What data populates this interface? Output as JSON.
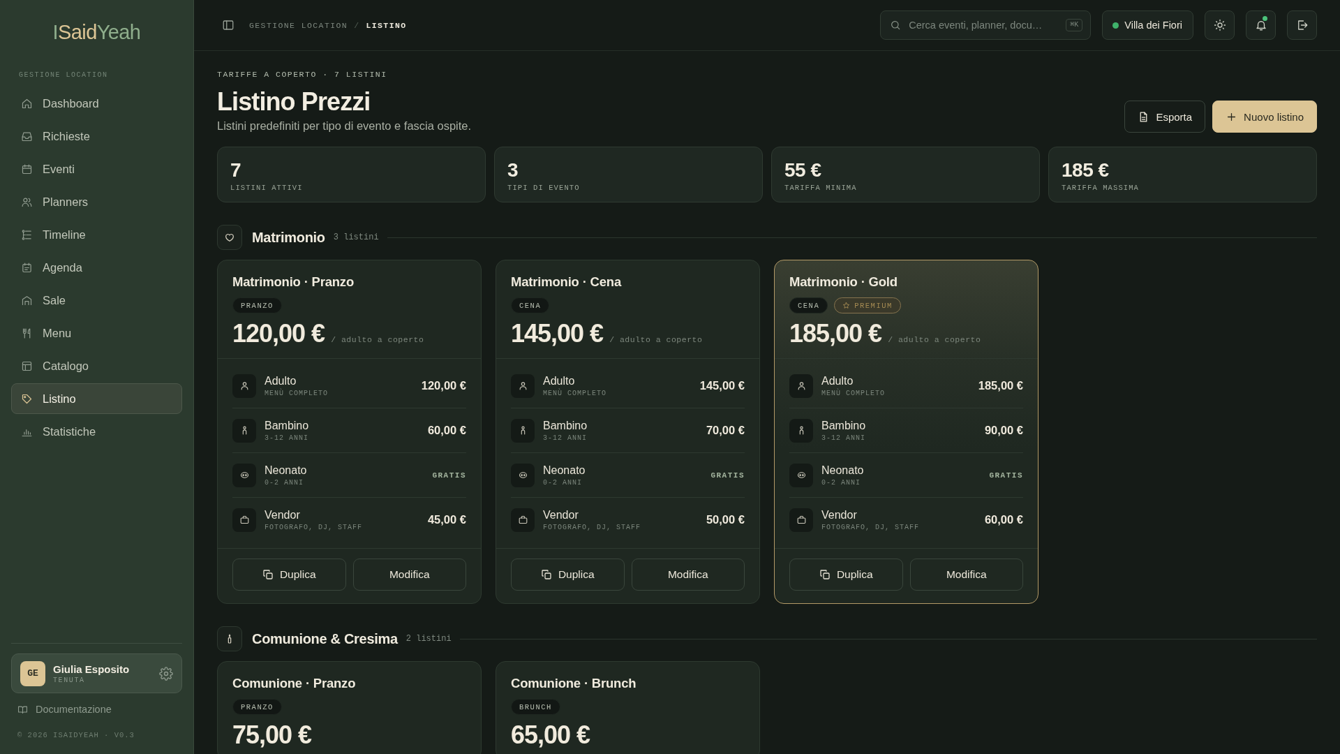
{
  "sidebar": {
    "logo": [
      {
        "text": "I",
        "color": "#8fae8c"
      },
      {
        "text": "Said",
        "color": "#dcc595"
      },
      {
        "text": "Yeah",
        "color": "#8fae8c"
      }
    ],
    "section_label": "GESTIONE LOCATION",
    "items": [
      {
        "label": "Dashboard",
        "kind": "home",
        "selected": false
      },
      {
        "label": "Richieste",
        "kind": "inbox",
        "selected": false
      },
      {
        "label": "Eventi",
        "kind": "calendar",
        "selected": false
      },
      {
        "label": "Planners",
        "kind": "users",
        "selected": false
      },
      {
        "label": "Timeline",
        "kind": "timeline",
        "selected": false
      },
      {
        "label": "Agenda",
        "kind": "agenda",
        "selected": false
      },
      {
        "label": "Sale",
        "kind": "venue",
        "selected": false
      },
      {
        "label": "Menu",
        "kind": "menu",
        "selected": false
      },
      {
        "label": "Catalogo",
        "kind": "catalog",
        "selected": false
      },
      {
        "label": "Listino",
        "kind": "tag",
        "selected": true
      },
      {
        "label": "Statistiche",
        "kind": "chart",
        "selected": false
      }
    ],
    "user": {
      "initials": "GE",
      "name": "Giulia Esposito",
      "role": "TENUTA"
    },
    "docs_link": "Documentazione",
    "footer": "© 2026 ISAIDYEAH · V0.3"
  },
  "topbar": {
    "breadcrumb": {
      "items": [
        "GESTIONE LOCATION",
        "LISTINO"
      ],
      "separator": "/"
    },
    "search": {
      "placeholder": "Cerca eventi, planner, docu…",
      "shortcut": "⌘K"
    },
    "venue": {
      "name": "Villa dei Fiori",
      "active": true
    },
    "notifications": {
      "unread": true
    }
  },
  "page": {
    "eyebrow": "TARIFFE A COPERTO · 7 LISTINI",
    "title": "Listino Prezzi",
    "subtitle": "Listini predefiniti per tipo di evento e fascia ospite.",
    "actions": [
      {
        "label": "Esporta",
        "kind": "export"
      },
      {
        "label": "Nuovo listino",
        "kind": "create"
      }
    ]
  },
  "stats": [
    {
      "value": "7",
      "label": "LISTINI ATTIVI"
    },
    {
      "value": "3",
      "label": "TIPI DI EVENTO"
    },
    {
      "value": "55 €",
      "label": "TARIFFA MINIMA"
    },
    {
      "value": "185 €",
      "label": "TARIFFA MASSIMA"
    }
  ],
  "sections": [
    {
      "title": "Matrimonio",
      "count": "3 listini",
      "kind": "wedding",
      "cards": [
        {
          "title": "Matrimonio · Pranzo",
          "featured": false,
          "tags": [
            {
              "label": "PRANZO",
              "kind": "meal"
            }
          ],
          "price": "120,00 €",
          "unit": "/ adulto a coperto",
          "rows": [
            {
              "kind": "adult",
              "name": "Adulto",
              "note": "MENÙ COMPLETO",
              "price": "120,00 €",
              "free": false
            },
            {
              "kind": "child",
              "name": "Bambino",
              "note": "3-12 ANNI",
              "price": "60,00 €",
              "free": false
            },
            {
              "kind": "infant",
              "name": "Neonato",
              "note": "0-2 ANNI",
              "price": "GRATIS",
              "free": true
            },
            {
              "kind": "vendor",
              "name": "Vendor",
              "note": "FOTOGRAFO, DJ, STAFF",
              "price": "45,00 €",
              "free": false
            }
          ],
          "actions": [
            {
              "label": "Duplica",
              "kind": "duplicate"
            },
            {
              "label": "Modifica",
              "kind": "edit"
            }
          ]
        },
        {
          "title": "Matrimonio · Cena",
          "featured": false,
          "tags": [
            {
              "label": "CENA",
              "kind": "meal"
            }
          ],
          "price": "145,00 €",
          "unit": "/ adulto a coperto",
          "rows": [
            {
              "kind": "adult",
              "name": "Adulto",
              "note": "MENÙ COMPLETO",
              "price": "145,00 €",
              "free": false
            },
            {
              "kind": "child",
              "name": "Bambino",
              "note": "3-12 ANNI",
              "price": "70,00 €",
              "free": false
            },
            {
              "kind": "infant",
              "name": "Neonato",
              "note": "0-2 ANNI",
              "price": "GRATIS",
              "free": true
            },
            {
              "kind": "vendor",
              "name": "Vendor",
              "note": "FOTOGRAFO, DJ, STAFF",
              "price": "50,00 €",
              "free": false
            }
          ],
          "actions": [
            {
              "label": "Duplica",
              "kind": "duplicate"
            },
            {
              "label": "Modifica",
              "kind": "edit"
            }
          ]
        },
        {
          "title": "Matrimonio · Gold",
          "featured": true,
          "tags": [
            {
              "label": "CENA",
              "kind": "meal"
            },
            {
              "label": "PREMIUM",
              "kind": "premium"
            }
          ],
          "price": "185,00 €",
          "unit": "/ adulto a coperto",
          "rows": [
            {
              "kind": "adult",
              "name": "Adulto",
              "note": "MENÙ COMPLETO",
              "price": "185,00 €",
              "free": false
            },
            {
              "kind": "child",
              "name": "Bambino",
              "note": "3-12 ANNI",
              "price": "90,00 €",
              "free": false
            },
            {
              "kind": "infant",
              "name": "Neonato",
              "note": "0-2 ANNI",
              "price": "GRATIS",
              "free": true
            },
            {
              "kind": "vendor",
              "name": "Vendor",
              "note": "FOTOGRAFO, DJ, STAFF",
              "price": "60,00 €",
              "free": false
            }
          ],
          "actions": [
            {
              "label": "Duplica",
              "kind": "duplicate"
            },
            {
              "label": "Modifica",
              "kind": "edit"
            }
          ]
        }
      ]
    },
    {
      "title": "Comunione & Cresima",
      "count": "2 listini",
      "kind": "communion",
      "cards": [
        {
          "title": "Comunione · Pranzo",
          "featured": false,
          "tags": [
            {
              "label": "PRANZO",
              "kind": "meal"
            }
          ],
          "price": "75,00 €"
        },
        {
          "title": "Comunione · Brunch",
          "featured": false,
          "tags": [
            {
              "label": "BRUNCH",
              "kind": "meal"
            }
          ],
          "price": "65,00 €"
        }
      ]
    }
  ]
}
